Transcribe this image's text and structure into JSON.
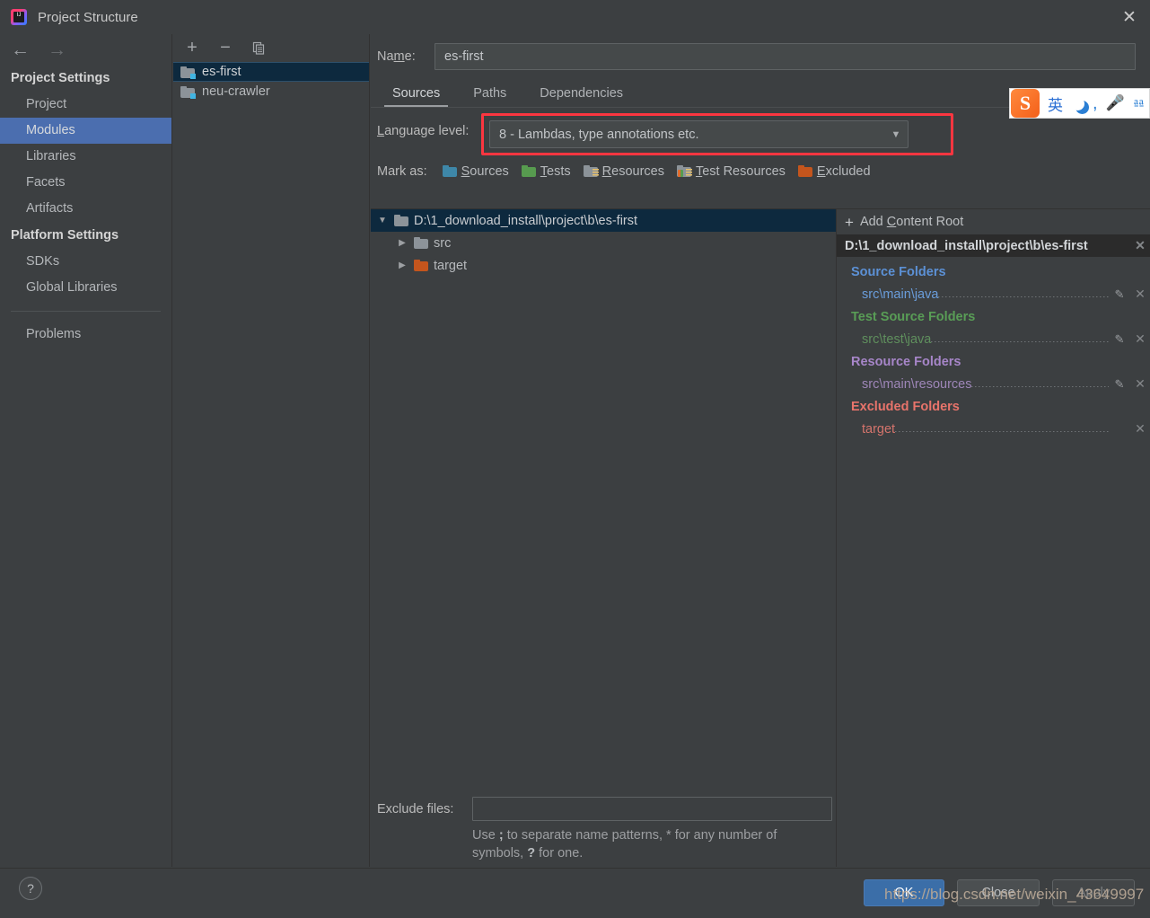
{
  "window": {
    "title": "Project Structure",
    "app_icon": "intellij-idea-icon",
    "close_icon": "✕"
  },
  "nav": {
    "back_icon": "←",
    "forward_icon": "→"
  },
  "sidebar": {
    "groups": [
      {
        "label": "Project Settings",
        "items": [
          {
            "label": "Project",
            "selected": false
          },
          {
            "label": "Modules",
            "selected": true
          },
          {
            "label": "Libraries",
            "selected": false
          },
          {
            "label": "Facets",
            "selected": false
          },
          {
            "label": "Artifacts",
            "selected": false
          }
        ]
      },
      {
        "label": "Platform Settings",
        "items": [
          {
            "label": "SDKs",
            "selected": false
          },
          {
            "label": "Global Libraries",
            "selected": false
          }
        ]
      }
    ],
    "problems": "Problems"
  },
  "modules_panel": {
    "toolbar": {
      "add": "+",
      "remove": "−",
      "copy": "copy-icon"
    },
    "items": [
      {
        "label": "es-first",
        "selected": true
      },
      {
        "label": "neu-crawler",
        "selected": false
      }
    ]
  },
  "main": {
    "name_label_pre": "Na",
    "name_label_underline": "m",
    "name_label_post": "e:",
    "name_value": "es-first",
    "tabs": [
      {
        "label": "Sources",
        "active": true
      },
      {
        "label": "Paths",
        "active": false
      },
      {
        "label": "Dependencies",
        "active": false
      }
    ],
    "language_level": {
      "label_underline": "L",
      "label_rest": "anguage level:",
      "value": "8 - Lambdas, type annotations etc.",
      "arrow": "▼",
      "highlight_color": "#fb3640"
    },
    "mark_as": {
      "label": "Mark as:",
      "items": [
        {
          "underline": "S",
          "rest": "ources",
          "kind": "src"
        },
        {
          "underline": "T",
          "rest": "ests",
          "kind": "test"
        },
        {
          "underline": "R",
          "rest": "esources",
          "kind": "res"
        },
        {
          "underline": "T",
          "rest": "est Resources",
          "kind": "tres",
          "prefix": ""
        },
        {
          "underline": "E",
          "rest": "xcluded",
          "kind": "excl"
        }
      ]
    },
    "tree": [
      {
        "label": "D:\\1_download_install\\project\\b\\es-first",
        "twisty": "▼",
        "indent": 0,
        "folder": "grey",
        "selected": true
      },
      {
        "label": "src",
        "twisty": "▶",
        "indent": 1,
        "folder": "grey",
        "selected": false
      },
      {
        "label": "target",
        "twisty": "▶",
        "indent": 1,
        "folder": "orange",
        "selected": false
      }
    ],
    "exclude": {
      "label": "Exclude files:",
      "value": "",
      "hint_1": "Use ",
      "hint_semicolon": ";",
      "hint_2": " to separate name patterns, * for any number of symbols, ",
      "hint_question": "?",
      "hint_3": " for one.",
      "hint_full": "Use ; to separate name patterns, * for any number of symbols, ? for one."
    }
  },
  "right_panel": {
    "add_content_root": {
      "plus": "+",
      "pre": "Add ",
      "underline": "C",
      "post": "ontent Root"
    },
    "content_root": {
      "path": "D:\\1_download_install\\project\\b\\es-first",
      "remove_icon": "✕"
    },
    "groups": [
      {
        "title": "Source Folders",
        "kind": "source",
        "rows": [
          {
            "name": "src\\main\\java",
            "has_edit": true,
            "has_remove": true
          }
        ]
      },
      {
        "title": "Test Source Folders",
        "kind": "test",
        "rows": [
          {
            "name": "src\\test\\java",
            "has_edit": true,
            "has_remove": true
          }
        ]
      },
      {
        "title": "Resource Folders",
        "kind": "resource",
        "rows": [
          {
            "name": "src\\main\\resources",
            "has_edit": true,
            "has_remove": true
          }
        ]
      },
      {
        "title": "Excluded Folders",
        "kind": "excluded",
        "rows": [
          {
            "name": "target",
            "has_edit": false,
            "has_remove": true
          }
        ]
      }
    ],
    "edit_icon": "✎",
    "remove_icon": "✕"
  },
  "footer": {
    "help": "?",
    "ok": "OK",
    "close": "Close",
    "apply": "Apply",
    "watermark": "https://blog.csdn.net/weixin_43649997"
  },
  "ime": {
    "logo": "S",
    "mode": "英",
    "moon_icon": "moon-icon",
    "comma_icon": "comma-icon",
    "mic_icon": "microphone-icon",
    "keyboard_icon": "keyboard-icon"
  },
  "colors": {
    "background": "#3c3f41",
    "selection_blue": "#4b6eaf",
    "tree_selection": "#0d293e",
    "accent_red": "#fb3640",
    "source_blue": "#5c91d6",
    "test_green": "#599d56",
    "resource_purple": "#a786c9",
    "excluded_red": "#e8746b"
  }
}
